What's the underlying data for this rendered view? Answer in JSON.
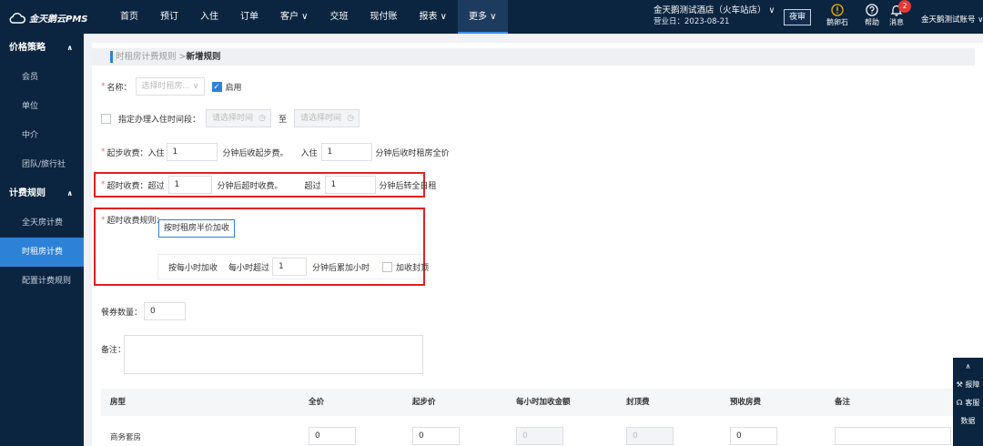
{
  "app": {
    "logo": "金天鹅云PMS"
  },
  "nav": [
    {
      "label": "首页"
    },
    {
      "label": "预订"
    },
    {
      "label": "入住"
    },
    {
      "label": "订单"
    },
    {
      "label": "客户 ∨"
    },
    {
      "label": "交班"
    },
    {
      "label": "现付账"
    },
    {
      "label": "报表 ∨"
    },
    {
      "label": "更多 ∨"
    }
  ],
  "hotel": {
    "name": "金天鹅测试酒店（火车站店）",
    "business_day": "营业日：2023-08-21",
    "caret": "∨"
  },
  "topbar": {
    "night_audit": "夜审",
    "tools": [
      {
        "label": "鹅卵石",
        "icon": "warning-circle-icon"
      },
      {
        "label": "帮助",
        "icon": "help-icon"
      },
      {
        "label": "消息",
        "icon": "bell-icon"
      }
    ],
    "message_count": "2",
    "account": "金天鹅测试账号 ∨"
  },
  "sidebar": {
    "groups": [
      {
        "title": "价格策略",
        "items": [
          "会员",
          "单位",
          "中介",
          "团队/旅行社"
        ]
      },
      {
        "title": "计费规则",
        "items": [
          "全天房计费",
          "时租房计费",
          "配置计费规则"
        ]
      }
    ],
    "active_item": "时租房计费"
  },
  "breadcrumb": {
    "parent": "时租房计费规则 >",
    "current": "新增规则"
  },
  "form": {
    "name_label": "名称：",
    "name_placeholder": "选择时租房...",
    "enabled_label": "启用",
    "checkin_period_label": "指定办理入住时间段：",
    "time_placeholder": "请选择时间",
    "to_label": "至",
    "start_fee_label": "起步收费：入住",
    "start_fee_value": "1",
    "start_fee_suffix": "分钟后收起步费。",
    "checkin_label": "入住",
    "full_price_value": "1",
    "full_price_suffix": "分钟后收时租房全价",
    "overtime_label": "超时收费：超过",
    "overtime_value": "1",
    "overtime_suffix": "分钟后超时收费。",
    "exceed_label": "超过",
    "fullday_value": "1",
    "fullday_suffix": "分钟后转全日租",
    "overtime_rule_label": "超时收费规则：",
    "half_price_button": "按时租房半价加收",
    "hourly_label": "按每小时加收",
    "per_hour_label": "每小时超过",
    "per_hour_value": "1",
    "per_hour_suffix": "分钟后累加小时",
    "cap_label": "加收封顶",
    "breakfast_label": "餐券数量：",
    "breakfast_value": "0",
    "remark_label": "备注："
  },
  "table": {
    "columns": [
      "房型",
      "全价",
      "起步价",
      "每小时加收金额",
      "封顶费",
      "预收房费",
      "备注"
    ],
    "rows": [
      {
        "room_type": "商务套房",
        "full": "0",
        "start": "0",
        "hourly": "0",
        "cap": "0",
        "prepaid": "0",
        "remark": ""
      }
    ]
  },
  "float_bar": {
    "up": "∧",
    "report": "报障",
    "service": "客服",
    "data": "数据"
  }
}
